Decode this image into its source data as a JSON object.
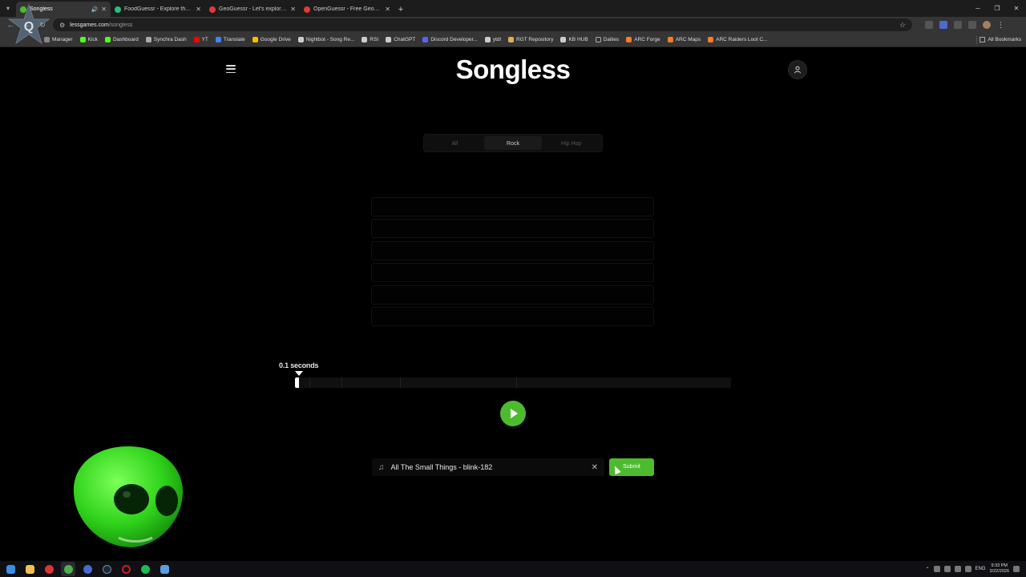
{
  "browser": {
    "tabs": [
      {
        "title": "Songless",
        "active": true,
        "favicon_color": "#4dbb2e",
        "audio": true
      },
      {
        "title": "FoodGuessr - Explore the world",
        "active": false,
        "favicon_color": "#2dbd7a"
      },
      {
        "title": "GeoGuessr - Let's explore the w",
        "active": false,
        "favicon_color": "#e03a3a"
      },
      {
        "title": "OpenGuessr - Free GeoGuessr",
        "active": false,
        "favicon_color": "#e53935"
      }
    ],
    "url_host": "lessgames.com",
    "url_path": "/songless",
    "bookmarks": [
      {
        "label": "Manager",
        "color": "#888"
      },
      {
        "label": "Kick",
        "color": "#53fc18"
      },
      {
        "label": "Dashboard",
        "color": "#53fc18"
      },
      {
        "label": "Synchra Dash",
        "color": "#aaa"
      },
      {
        "label": "YT",
        "color": "#ff0000"
      },
      {
        "label": "Translate",
        "color": "#4285f4"
      },
      {
        "label": "Google Drive",
        "color": "#fbbc04"
      },
      {
        "label": "Nightbot - Song Re...",
        "color": "#ccc"
      },
      {
        "label": "RSI",
        "color": "#ccc"
      },
      {
        "label": "ChatGPT",
        "color": "#ccc"
      },
      {
        "label": "Discord Developer...",
        "color": "#5865f2"
      },
      {
        "label": "ytdl",
        "color": "#ccc"
      },
      {
        "label": "RGT Repository",
        "color": "#e0b050"
      },
      {
        "label": "KB HUB",
        "color": "#ccc"
      },
      {
        "label": "Dailies",
        "color": "#aaa"
      },
      {
        "label": "ARC Forge",
        "color": "#ff7a2a"
      },
      {
        "label": "ARC Maps",
        "color": "#ff7a2a"
      },
      {
        "label": "ARC Raiders Loot C...",
        "color": "#ff7a2a"
      }
    ],
    "all_bookmarks": "All Bookmarks"
  },
  "page": {
    "logo": "Songless",
    "genres": [
      {
        "label": "All",
        "active": false
      },
      {
        "label": "Rock",
        "active": true
      },
      {
        "label": "Hip Hop",
        "active": false
      }
    ],
    "guess_slots": 6,
    "time_label": "0.1 seconds",
    "played_fraction": 0.01,
    "answer_value": "All The Small Things - blink-182",
    "submit_label": "Submit",
    "accent": "#4dbb2e"
  },
  "taskbar": {
    "lang": "ENG",
    "time": "9:33 PM",
    "date": "3/22/2026"
  }
}
